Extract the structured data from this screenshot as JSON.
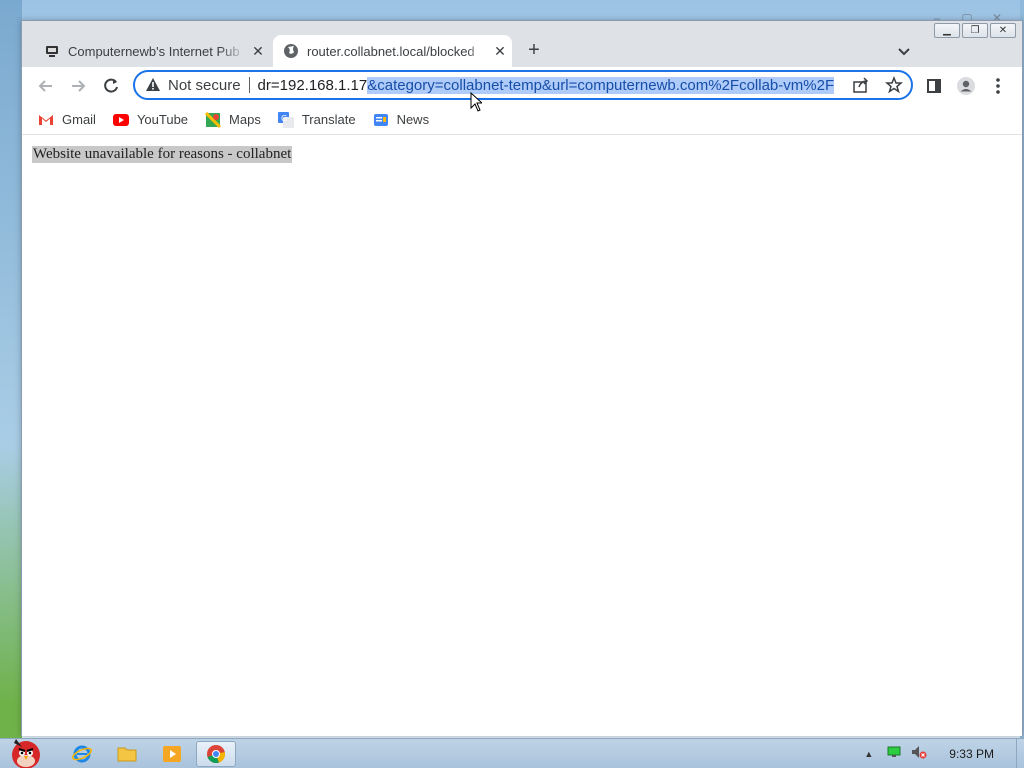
{
  "tabs": [
    {
      "title": "Computernewb's Internet Pub",
      "close": "✕"
    },
    {
      "title": "router.collabnet.local/blocked",
      "close": "✕"
    }
  ],
  "new_tab": "+",
  "address_bar": {
    "security_label": "Not secure",
    "url_plain": "dr=192.168.1.17",
    "url_selected": "&category=collabnet-temp&url=computernewb.com%2Fcollab-vm%2F"
  },
  "bookmarks": [
    {
      "label": "Gmail",
      "icon": "gmail-icon"
    },
    {
      "label": "YouTube",
      "icon": "youtube-icon"
    },
    {
      "label": "Maps",
      "icon": "maps-icon"
    },
    {
      "label": "Translate",
      "icon": "translate-icon"
    },
    {
      "label": "News",
      "icon": "news-icon"
    }
  ],
  "page": {
    "message": "Website unavailable for reasons - collabnet"
  },
  "taskbar": {
    "clock": "9:33 PM"
  },
  "colors": {
    "accent": "#1a73e8",
    "selection": "#aecbfa"
  }
}
